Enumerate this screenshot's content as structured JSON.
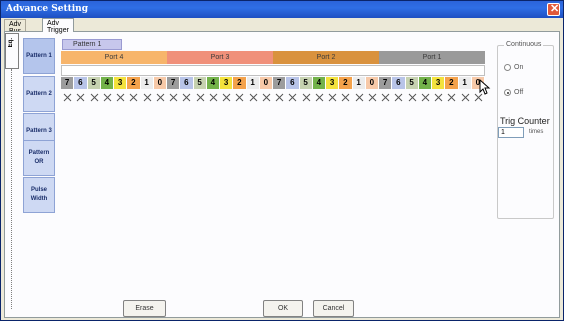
{
  "window": {
    "title": "Advance Setting"
  },
  "tabs": [
    {
      "label": "Adv Bus"
    },
    {
      "label": "Adv Trigger"
    }
  ],
  "vertical_tab": {
    "label": "Eq."
  },
  "side_buttons": [
    {
      "label": "Pattern 1"
    },
    {
      "label": "Pattern 2"
    },
    {
      "label": "Pattern 3"
    },
    {
      "label": "Pattern OR"
    },
    {
      "label": "Pulse Width"
    }
  ],
  "pattern_tab": {
    "label": "Pattern 1"
  },
  "ports": [
    {
      "label": "Port 4",
      "color": "#f7b56b"
    },
    {
      "label": "Port 3",
      "color": "#f0907a"
    },
    {
      "label": "Port 2",
      "color": "#d9923e"
    },
    {
      "label": "Port 1",
      "color": "#9a9a9a"
    }
  ],
  "bit_labels": [
    "7",
    "6",
    "5",
    "4",
    "3",
    "2",
    "1",
    "0"
  ],
  "bit_colors": [
    "#9c9c9c",
    "#b8c4e8",
    "#c6d2b0",
    "#73b24a",
    "#f3e23d",
    "#f4a24b",
    "#ececec",
    "#f7c9a8"
  ],
  "continuous": {
    "legend": "Continuous",
    "options": [
      {
        "label": "On",
        "checked": false
      },
      {
        "label": "Off",
        "checked": true
      }
    ]
  },
  "trig_counter": {
    "label": "Trig Counter",
    "value": "1",
    "unit": "times"
  },
  "buttons": {
    "erase": "Erase",
    "ok": "OK",
    "cancel": "Cancel"
  }
}
